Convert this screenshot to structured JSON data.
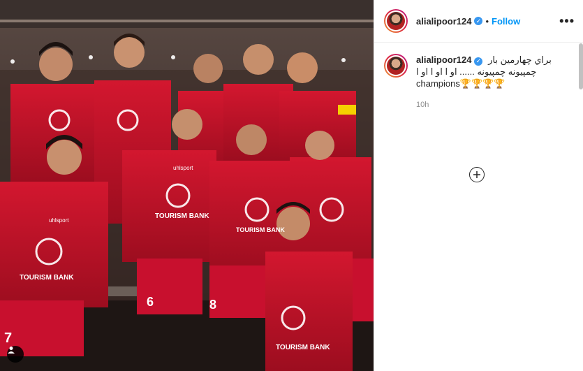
{
  "post": {
    "username": "alialipoor124",
    "follow_label": "Follow",
    "dot": "•",
    "more_label": "•••"
  },
  "caption": {
    "username": "alialipoor124",
    "line1": "براي چهارمين بار",
    "line2": "چمپیونه چمپیونه ...... او ا او ا او ا",
    "line3": "champions🏆🏆🏆🏆",
    "time": "10h"
  },
  "photo": {
    "sponsor": "TOURISM BANK",
    "brand": "uhlsport",
    "jersey_numbers": [
      "6",
      "8",
      "7"
    ]
  },
  "icons": {
    "verified": "verified-badge-icon",
    "add": "add-circle-icon",
    "user_tag": "user-tag-icon"
  },
  "colors": {
    "follow": "#0095f6",
    "jersey": "#c8102e",
    "background_room": "#2a1e1b"
  }
}
